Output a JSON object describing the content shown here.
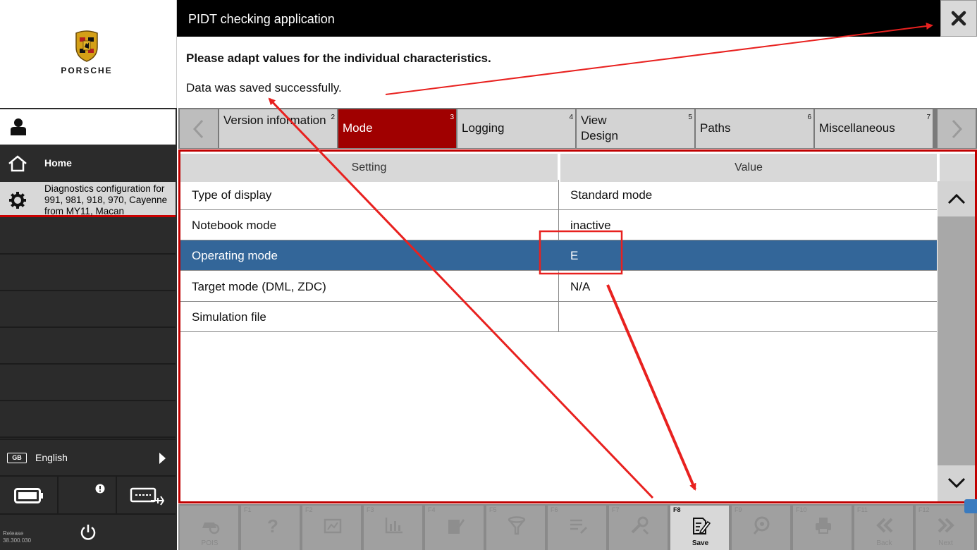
{
  "brand": {
    "name": "PORSCHE"
  },
  "sidebar": {
    "home_label": "Home",
    "diagnostics_label": "Diagnostics configuration for 991, 981, 918, 970, Cayenne from MY11, Macan",
    "language_code": "GB",
    "language_label": "English",
    "release_label": "Release",
    "release_version": "38.300.030"
  },
  "header": {
    "title": "PIDT checking application",
    "heading": "Please adapt values for the individual characteristics.",
    "status_message": "Data was saved successfully."
  },
  "tabs": [
    {
      "label": "Version information",
      "number": "2"
    },
    {
      "label": "Mode",
      "number": "3",
      "active": true
    },
    {
      "label": "Logging",
      "number": "4"
    },
    {
      "label": "View Design",
      "number": "5"
    },
    {
      "label": "Paths",
      "number": "6"
    },
    {
      "label": "Miscellaneous",
      "number": "7"
    }
  ],
  "table": {
    "columns": [
      "Setting",
      "Value"
    ],
    "rows": [
      {
        "setting": "Type of display",
        "value": "Standard mode"
      },
      {
        "setting": "Notebook mode",
        "value": "inactive"
      },
      {
        "setting": "Operating mode",
        "value": "E",
        "selected": true
      },
      {
        "setting": "Target mode (DML, ZDC)",
        "value": "N/A"
      },
      {
        "setting": "Simulation file",
        "value": ""
      }
    ]
  },
  "function_keys": [
    {
      "key": "",
      "label": "POIS",
      "icon": "car-search-icon"
    },
    {
      "key": "F1",
      "label": "",
      "icon": "help-icon"
    },
    {
      "key": "F2",
      "label": "",
      "icon": "gauge-icon"
    },
    {
      "key": "F3",
      "label": "",
      "icon": "chart-icon"
    },
    {
      "key": "F4",
      "label": "",
      "icon": "edit-doc-icon"
    },
    {
      "key": "F5",
      "label": "",
      "icon": "filter-icon"
    },
    {
      "key": "F6",
      "label": "",
      "icon": "list-edit-icon"
    },
    {
      "key": "F7",
      "label": "",
      "icon": "tools-icon"
    },
    {
      "key": "F8",
      "label": "Save",
      "icon": "save-doc-icon",
      "enabled": true
    },
    {
      "key": "F9",
      "label": "",
      "icon": "search-settings-icon"
    },
    {
      "key": "F10",
      "label": "",
      "icon": "print-icon"
    },
    {
      "key": "F11",
      "label": "Back",
      "icon": "back-icon"
    },
    {
      "key": "F12",
      "label": "Next",
      "icon": "next-icon"
    }
  ],
  "colors": {
    "accent": "#a00000",
    "selection": "#336699",
    "annotation": "#e8211f"
  }
}
